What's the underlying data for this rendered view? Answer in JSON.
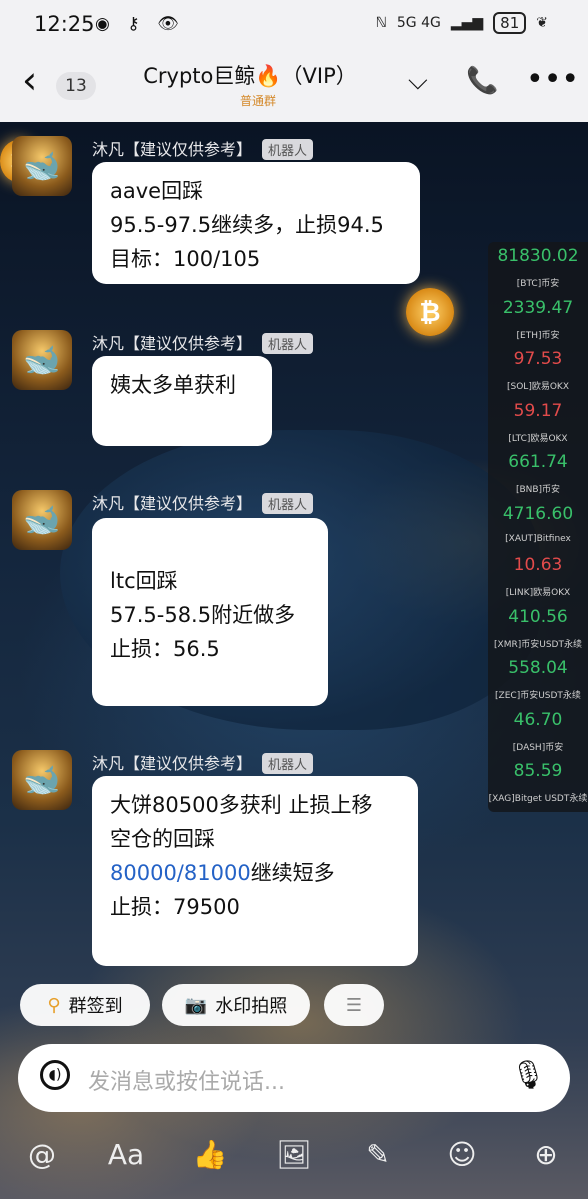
{
  "status_bar": {
    "time": "12:25",
    "icons_left": "◉ ⚷ 👁",
    "network": "5G 4G",
    "battery": "81"
  },
  "header": {
    "back_count": "13",
    "title": "Crypto巨鲸🔥（VIP）",
    "subtitle": "普通群"
  },
  "messages": [
    {
      "sender": "沐凡【建议仅供参考】",
      "tag": "机器人",
      "lines": [
        "aave回踩",
        "95.5-97.5继续多，止损94.5",
        "目标：100/105"
      ]
    },
    {
      "sender": "沐凡【建议仅供参考】",
      "tag": "机器人",
      "lines": [
        "姨太多单获利"
      ]
    },
    {
      "sender": "沐凡【建议仅供参考】",
      "tag": "机器人",
      "lines": [
        "ltc回踩",
        "57.5-58.5附近做多",
        "止损：56.5"
      ]
    },
    {
      "sender": "沐凡【建议仅供参考】",
      "tag": "机器人",
      "lines": [
        "大饼80500多获利 止损上移",
        "空仓的回踩"
      ],
      "link": "80000/81000",
      "link_suffix": "继续短多",
      "last": "止损：79500"
    }
  ],
  "ticker": [
    {
      "value": "81830.02",
      "trend": "up",
      "label": "[BTC]币安"
    },
    {
      "value": "2339.47",
      "trend": "up",
      "label": "[ETH]币安"
    },
    {
      "value": "97.53",
      "trend": "down",
      "label": "[SOL]欧易OKX"
    },
    {
      "value": "59.17",
      "trend": "down",
      "label": "[LTC]欧易OKX"
    },
    {
      "value": "661.74",
      "trend": "up",
      "label": "[BNB]币安"
    },
    {
      "value": "4716.60",
      "trend": "up",
      "label": "[XAUT]Bitfinex"
    },
    {
      "value": "10.63",
      "trend": "down",
      "label": "[LINK]欧易OKX"
    },
    {
      "value": "410.56",
      "trend": "up",
      "label": "[XMR]币安USDT永续"
    },
    {
      "value": "558.04",
      "trend": "up",
      "label": "[ZEC]币安USDT永续"
    },
    {
      "value": "46.70",
      "trend": "up",
      "label": "[DASH]币安"
    },
    {
      "value": "85.59",
      "trend": "up",
      "label": "[XAG]Bitget USDT永续"
    }
  ],
  "quick_actions": {
    "checkin": "群签到",
    "watermark": "水印拍照",
    "more": "☰"
  },
  "input": {
    "placeholder": "发消息或按住说话..."
  },
  "toolbar_icons": [
    "at-icon",
    "font-icon",
    "thumbs-up-icon",
    "image-icon",
    "ai-icon",
    "emoji-icon",
    "plus-icon"
  ],
  "colors": {
    "up": "#39c06a",
    "down": "#e24b4b",
    "link": "#2462c6",
    "badge": "#d4892a"
  }
}
